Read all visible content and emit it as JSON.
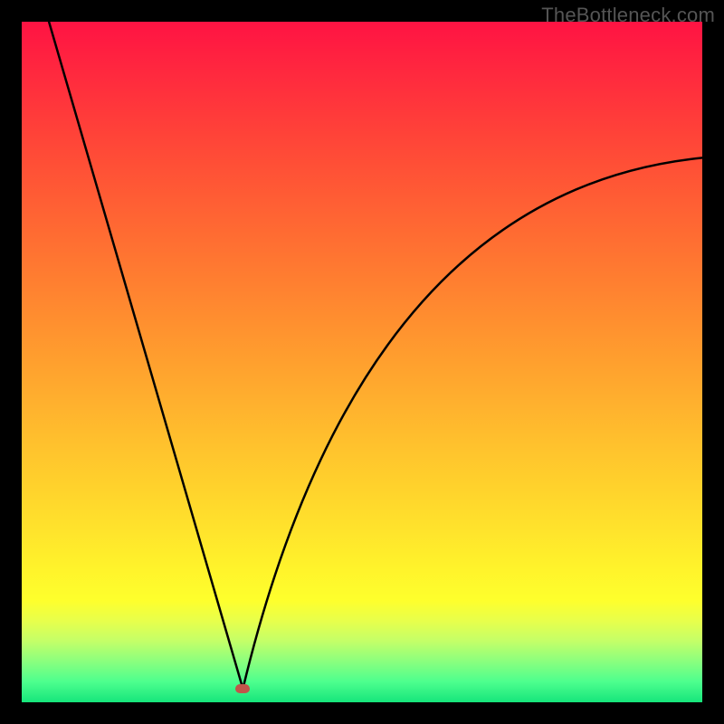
{
  "watermark": "TheBottleneck.com",
  "chart_data": {
    "type": "line",
    "x_range": [
      0,
      100
    ],
    "y_range": [
      0,
      100
    ],
    "left_branch": [
      {
        "x": 4.0,
        "y": 100
      },
      {
        "x": 32.5,
        "y": 2.0
      }
    ],
    "right_branch_bezier": {
      "start": {
        "x": 32.5,
        "y": 2.0
      },
      "control": {
        "x": 50.0,
        "y": 75.0
      },
      "end": {
        "x": 100.0,
        "y": 80.0
      }
    },
    "minimum": {
      "x": 32.5,
      "y": 2.0
    },
    "min_marker_color": "#c1554a",
    "title": "",
    "xlabel": "",
    "ylabel": "",
    "gradient_colors": [
      {
        "stop": 0,
        "color": "#ff1343"
      },
      {
        "stop": 100,
        "color": "#16e57b"
      }
    ]
  }
}
